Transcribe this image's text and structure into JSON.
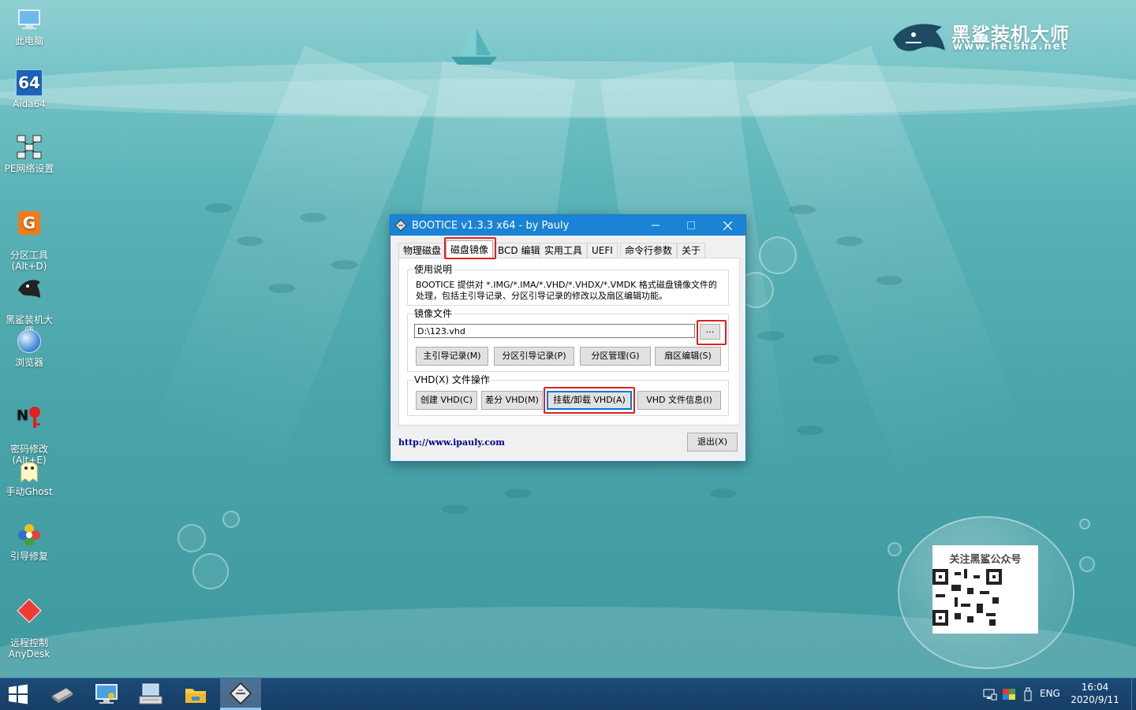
{
  "desktop": {
    "icons": [
      {
        "label": "此电脑",
        "icon": "computer-icon"
      },
      {
        "label": "Aida64",
        "icon": "aida64-icon"
      },
      {
        "label": "PE网络设置",
        "icon": "network-icon"
      },
      {
        "label": "分区工具\n(Alt+D)",
        "icon": "partition-tool-icon"
      },
      {
        "label": "黑鲨装机大\n师",
        "icon": "shark-icon"
      },
      {
        "label": "浏览器",
        "icon": "browser-icon"
      },
      {
        "label": "密码修改\n(Alt+E)",
        "icon": "password-icon"
      },
      {
        "label": "手动Ghost",
        "icon": "ghost-icon"
      },
      {
        "label": "引导修复",
        "icon": "boot-repair-icon"
      },
      {
        "label": "远程控制\nAnyDesk",
        "icon": "anydesk-icon"
      }
    ],
    "logo": {
      "title": "黑鲨装机大师",
      "url": "www.heisha.net"
    },
    "qr": {
      "title": "关注黑鲨公众号"
    }
  },
  "window": {
    "title": "BOOTICE v1.3.3 x64 - by Pauly",
    "tabs": [
      "物理磁盘",
      "磁盘镜像",
      "BCD 编辑",
      "实用工具",
      "UEFI",
      "命令行参数",
      "关于"
    ],
    "active_tab": "磁盘镜像",
    "usage": {
      "title": "使用说明",
      "text": "BOOTICE 提供对 *.IMG/*.IMA/*.VHD/*.VHDX/*.VMDK 格式磁盘镜像文件的处理，包括主引导记录、分区引导记录的修改以及扇区编辑功能。"
    },
    "image_file": {
      "title": "镜像文件",
      "path": "D:\\123.vhd",
      "browse_label": "...",
      "buttons": [
        "主引导记录(M)",
        "分区引导记录(P)",
        "分区管理(G)",
        "扇区编辑(S)"
      ]
    },
    "vhd_ops": {
      "title": "VHD(X) 文件操作",
      "buttons": [
        "创建 VHD(C)",
        "差分 VHD(M)",
        "挂载/卸载 VHD(A)",
        "VHD 文件信息(I)"
      ]
    },
    "link": "http://www.ipauly.com",
    "exit_label": "退出(X)"
  },
  "taskbar": {
    "apps": [
      "drive-app",
      "system-app",
      "keyboard-app",
      "explorer-app",
      "bootice-app"
    ],
    "language": "ENG",
    "time": "16:04",
    "date": "2020/9/11"
  },
  "colors": {
    "highlight_red": "#e02020",
    "titlebar_blue": "#1a83d6",
    "taskbar": "#163e66"
  }
}
